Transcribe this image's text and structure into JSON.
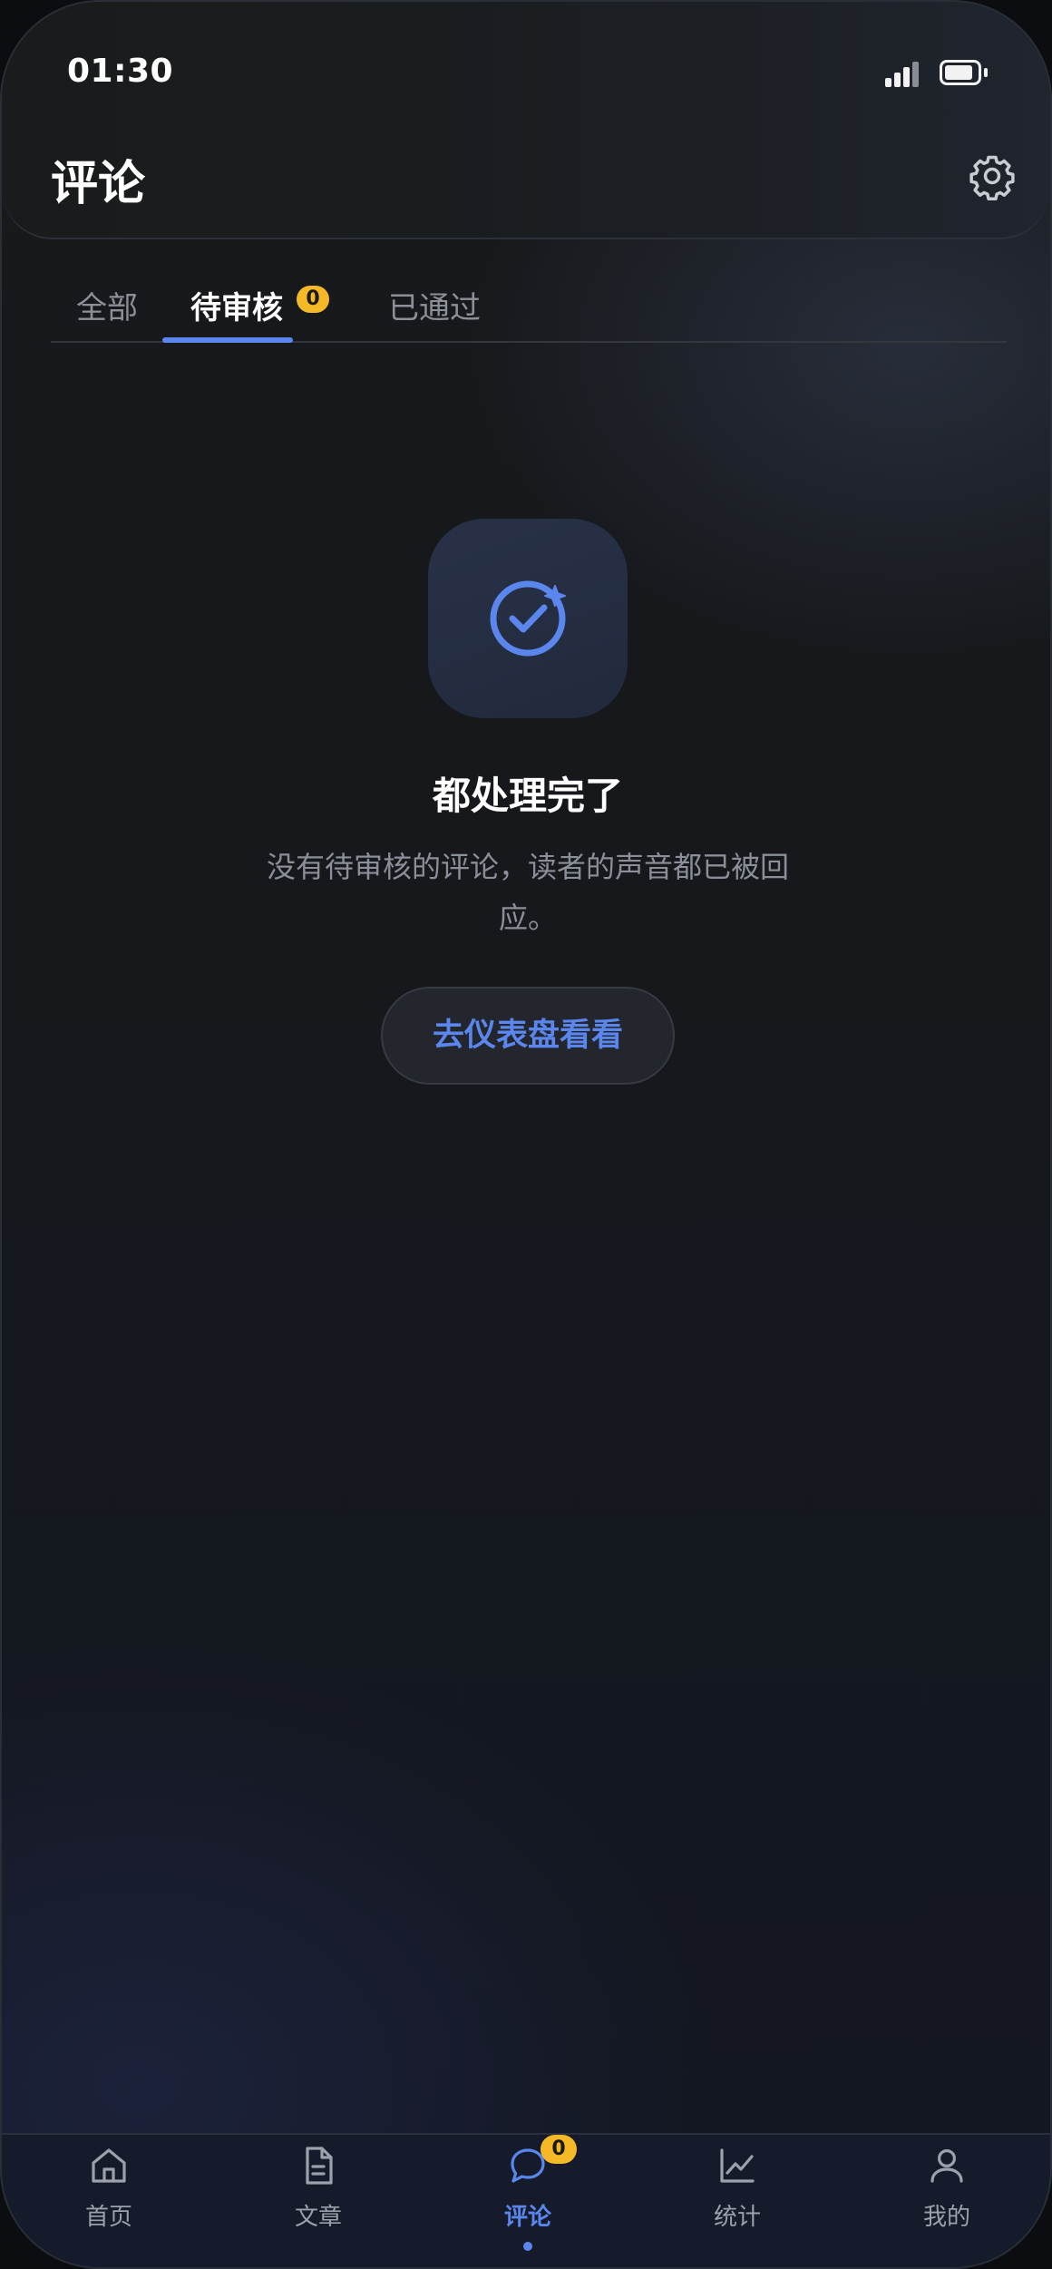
{
  "status_bar": {
    "time": "01:30",
    "icons": [
      "signal-icon",
      "battery-icon"
    ]
  },
  "header": {
    "title": "评论",
    "settings_icon": "gear-icon"
  },
  "tabs": [
    {
      "label": "全部",
      "active": false
    },
    {
      "label": "待审核",
      "active": true,
      "badge": "0"
    },
    {
      "label": "已通过",
      "active": false
    }
  ],
  "empty_state": {
    "icon": "check-circle-sparkle-icon",
    "title": "都处理完了",
    "description_line1": "没有待审核的评论，读者的声音都已被回",
    "description_line2": "应。",
    "button_label": "去仪表盘看看"
  },
  "bottom_nav": [
    {
      "label": "首页",
      "icon": "home-icon",
      "active": false
    },
    {
      "label": "文章",
      "icon": "document-icon",
      "active": false
    },
    {
      "label": "评论",
      "icon": "comment-icon",
      "active": true,
      "badge": "0"
    },
    {
      "label": "统计",
      "icon": "chart-icon",
      "active": false
    },
    {
      "label": "我的",
      "icon": "user-icon",
      "active": false
    }
  ],
  "colors": {
    "accent": "#5b86ee",
    "badge": "#f5b826",
    "text_primary": "#ffffff",
    "text_secondary": "#8a8f99"
  }
}
